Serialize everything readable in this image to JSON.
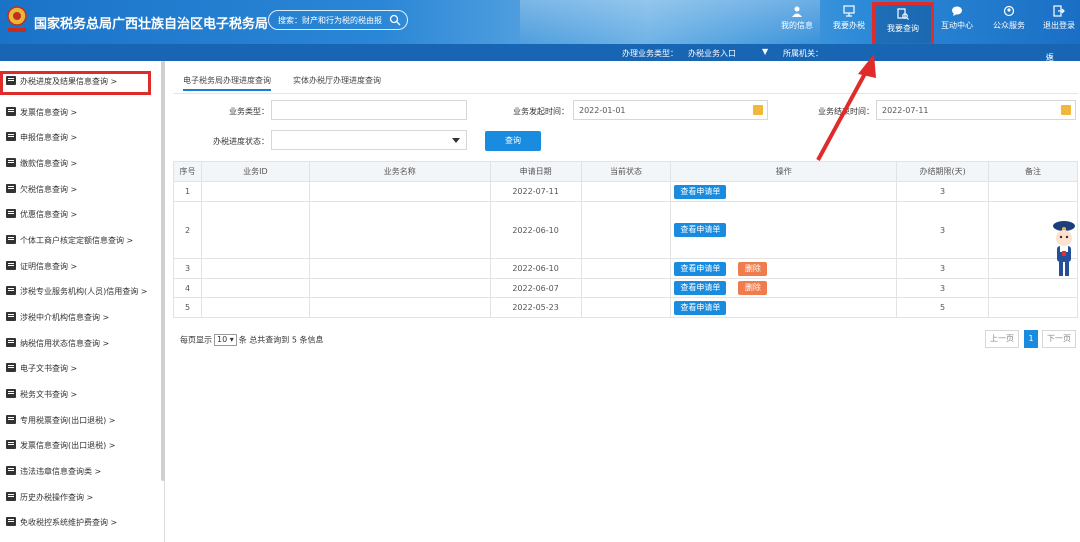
{
  "header": {
    "title": "国家税务总局广西壮族自治区电子税务局",
    "search_placeholder": "搜索：财产和行为税的税由报",
    "nav": [
      {
        "label": "我的信息",
        "icon": "user-icon"
      },
      {
        "label": "我要办税",
        "icon": "monitor-icon"
      },
      {
        "label": "我要查询",
        "icon": "search-doc-icon"
      },
      {
        "label": "互动中心",
        "icon": "chat-icon"
      },
      {
        "label": "公众服务",
        "icon": "people-icon"
      },
      {
        "label": "退出登录",
        "icon": "logout-icon"
      }
    ]
  },
  "subbar": {
    "type_label": "办理业务类型：",
    "type_value": "办税业务入口",
    "authority_label": "所属机关：",
    "back_label": "返回"
  },
  "sidebar": {
    "items": [
      "办税进度及结果信息查询 >",
      "发票信息查询 >",
      "申报信息查询 >",
      "缴款信息查询 >",
      "欠税信息查询 >",
      "优惠信息查询 >",
      "个体工商户核定定额信息查询 >",
      "证明信息查询 >",
      "涉税专业服务机构(人员)信用查询 >",
      "涉税中介机构信息查询 >",
      "纳税信用状态信息查询 >",
      "电子文书查询 >",
      "税务文书查询 >",
      "专用税票查询(出口退税) >",
      "发票信息查询(出口退税) >",
      "违法违章信息查询类 >",
      "历史办税操作查询 >",
      "免收税控系统维护费查询 >"
    ]
  },
  "tabs": [
    "电子税务局办理进度查询",
    "实体办税厅办理进度查询"
  ],
  "form": {
    "business_type_label": "业务类型：",
    "start_label": "业务发起时间：",
    "start_value": "2022-01-01",
    "end_label": "业务结束时间：",
    "end_value": "2022-07-11",
    "status_label": "办税进度状态：",
    "query_button": "查询"
  },
  "table": {
    "headers": [
      "序号",
      "业务ID",
      "业务名称",
      "申请日期",
      "当前状态",
      "操作",
      "办结期限(天)",
      "备注"
    ],
    "view_label": "查看申请单",
    "delete_label": "删除",
    "rows": [
      {
        "no": "1",
        "date": "2022-07-11",
        "limit": "3",
        "deletable": false
      },
      {
        "no": "2",
        "date": "2022-06-10",
        "limit": "3",
        "deletable": false
      },
      {
        "no": "3",
        "date": "2022-06-10",
        "limit": "3",
        "deletable": true
      },
      {
        "no": "4",
        "date": "2022-06-07",
        "limit": "3",
        "deletable": true
      },
      {
        "no": "5",
        "date": "2022-05-23",
        "limit": "5",
        "deletable": false
      }
    ]
  },
  "pager": {
    "per_page_prefix": "每页显示",
    "per_page_value": "10",
    "summary": "条  总共查询到 5 条信息",
    "prev": "上一页",
    "current": "1",
    "next": "下一页"
  },
  "colors": {
    "accent": "#1a8ce0",
    "highlight": "#e02b2b",
    "header": "#1b73c8"
  }
}
